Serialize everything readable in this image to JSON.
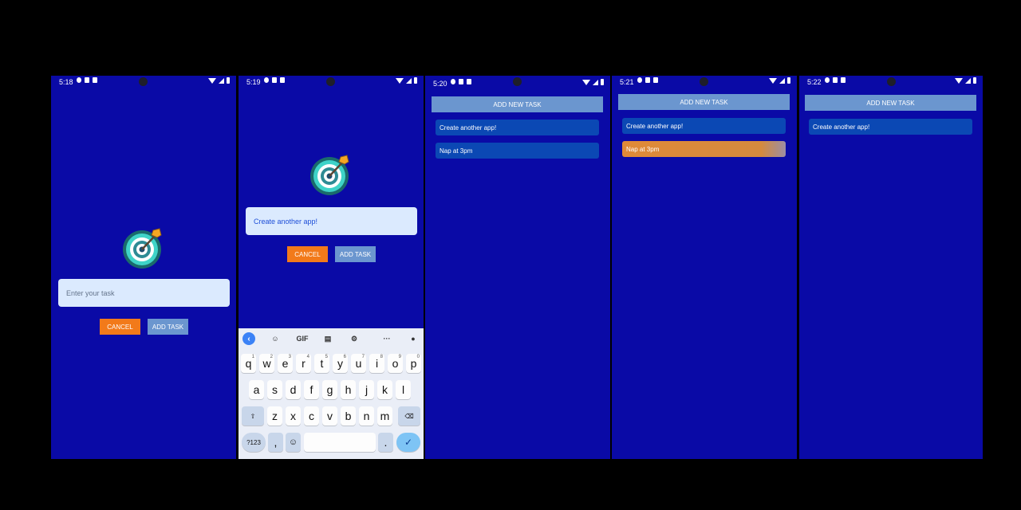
{
  "screens": [
    {
      "time": "5:18"
    },
    {
      "time": "5:19"
    },
    {
      "time": "5:20"
    },
    {
      "time": "5:21"
    },
    {
      "time": "5:22"
    }
  ],
  "input": {
    "placeholder": "Enter your task",
    "typed_value": "Create another app!"
  },
  "buttons": {
    "cancel": "CANCEL",
    "add_task": "ADD TASK",
    "add_new_task": "ADD NEW TASK"
  },
  "goals": {
    "first": "Create another app!",
    "second": "Nap at 3pm"
  },
  "keyboard": {
    "toolbar": {
      "gif": "GIF"
    },
    "row1": [
      "q",
      "w",
      "e",
      "r",
      "t",
      "y",
      "u",
      "i",
      "o",
      "p"
    ],
    "row1_hints": [
      "1",
      "2",
      "3",
      "4",
      "5",
      "6",
      "7",
      "8",
      "9",
      "0"
    ],
    "row2": [
      "a",
      "s",
      "d",
      "f",
      "g",
      "h",
      "j",
      "k",
      "l"
    ],
    "row3": [
      "z",
      "x",
      "c",
      "v",
      "b",
      "n",
      "m"
    ],
    "symbols": "?123",
    "comma": ",",
    "period": "."
  },
  "colors": {
    "screen_bg": "#0a0aa6",
    "cancel": "#f27a1a",
    "add": "#6b96cf",
    "goal_item": "#0b48b4",
    "goal_active": "#e08a38"
  },
  "icons": [
    "target-arrow-icon",
    "chevron-left-icon",
    "sticker-icon",
    "clipboard-icon",
    "gear-icon",
    "more-icon",
    "mic-icon",
    "shift-icon",
    "backspace-icon",
    "emoji-icon",
    "check-icon"
  ]
}
